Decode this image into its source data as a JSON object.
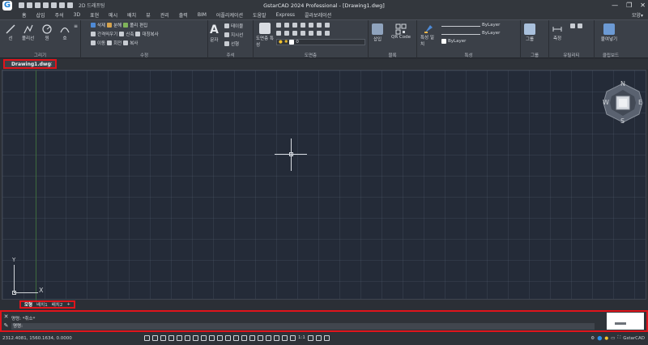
{
  "app": {
    "logo_letter": "G",
    "title": "GstarCAD 2024 Professional - [Drawing1.dwg]",
    "workspace": "2D 드래프팅",
    "brand": "GstarCAD"
  },
  "menubar": {
    "items": [
      "홈",
      "삽입",
      "주석",
      "3D",
      "표현",
      "메시",
      "배치",
      "뷰",
      "관리",
      "출력",
      "BIM",
      "어플리케이션",
      "도움말",
      "Express",
      "콜라보레이션"
    ],
    "right_label": "모양▾"
  },
  "ribbon": {
    "draw": {
      "title": "그리기",
      "line": "선",
      "polyline": "폴리선",
      "circle": "원",
      "arc": "호"
    },
    "modify": {
      "title": "수정",
      "rows": [
        [
          "삭제",
          "분해",
          "폴리 편집"
        ],
        [
          "간격띄우기",
          "신축",
          "대칭복사"
        ],
        [
          "이동",
          "회전",
          "복사"
        ]
      ]
    },
    "annotation": {
      "title": "주석",
      "text": "문자",
      "table": "테이블",
      "leader": "지시선",
      "linear": "선형"
    },
    "layers": {
      "title": "도면층",
      "props": "도면층 특성",
      "current": "0"
    },
    "block": {
      "title": "블록",
      "insert": "삽입",
      "qr": "QR Code"
    },
    "properties": {
      "title": "특성",
      "match": "특성 일치",
      "color": "ByLayer",
      "linetype": "ByLayer",
      "lineweight": "ByLayer"
    },
    "groups": {
      "title": "그룹",
      "group": "그룹"
    },
    "utilities": {
      "title": "유틸리티",
      "measure": "측정"
    },
    "clipboard": {
      "title": "클립보드",
      "paste": "붙여넣기"
    }
  },
  "document": {
    "tab_label": "Drawing1.dwg"
  },
  "viewcube": {
    "north": "N",
    "south": "S",
    "east": "E",
    "west": "W"
  },
  "ucs": {
    "x": "X",
    "y": "Y"
  },
  "layout_tabs": [
    "모형",
    "배치1",
    "배치2"
  ],
  "layout_add": "+",
  "command": {
    "history": "명령: *취소*",
    "prompt": "명령:"
  },
  "statusbar": {
    "coords": "2312.4081, 1560.1634, 0.0000",
    "scale": "1:1"
  },
  "colors": {
    "highlight": "#e0141b",
    "canvas_bg": "#242b38",
    "ribbon_bg": "#3b4048"
  }
}
